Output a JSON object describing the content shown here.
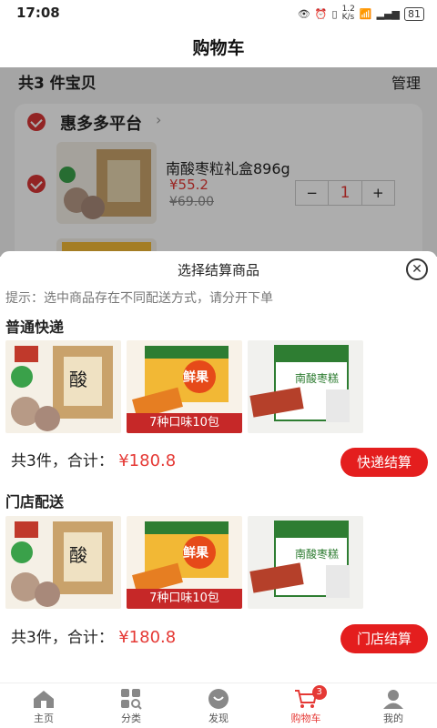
{
  "status_bar": {
    "time": "17:08",
    "net_speed": "1.2\nK/s",
    "battery": "81"
  },
  "header": {
    "title": "购物车"
  },
  "cart": {
    "summary": "共3 件宝贝",
    "manage_label": "管理",
    "store_name": "惠多多平台",
    "item": {
      "name": "南酸枣粒礼盒896g",
      "price": "¥55.2",
      "old_price": "¥69.00",
      "qty_minus": "−",
      "qty": "1",
      "qty_plus": "+"
    }
  },
  "sheet": {
    "title": "选择结算商品",
    "close_icon": "close-icon",
    "hint": "提示：选中商品存在不同配送方式，请分开下单",
    "groups": [
      {
        "title": "普通快递",
        "thumbs": [
          {
            "caption": ""
          },
          {
            "caption": "7种口味10包"
          },
          {
            "caption": ""
          }
        ],
        "total_prefix": "共3件，合计：",
        "total_price": "¥180.8",
        "button_label": "快递结算"
      },
      {
        "title": "门店配送",
        "thumbs": [
          {
            "caption": ""
          },
          {
            "caption": "7种口味10包"
          },
          {
            "caption": ""
          }
        ],
        "total_prefix": "共3件，合计：",
        "total_price": "¥180.8",
        "button_label": "门店结算"
      }
    ]
  },
  "bottom_nav": {
    "items": [
      {
        "label": "主页",
        "icon": "home-icon"
      },
      {
        "label": "分类",
        "icon": "category-icon"
      },
      {
        "label": "发现",
        "icon": "discover-icon"
      },
      {
        "label": "购物车",
        "icon": "cart-icon",
        "badge": "3",
        "active": true
      },
      {
        "label": "我的",
        "icon": "user-icon"
      }
    ]
  },
  "colors": {
    "accent": "#e41e1e",
    "price": "#e53935"
  }
}
